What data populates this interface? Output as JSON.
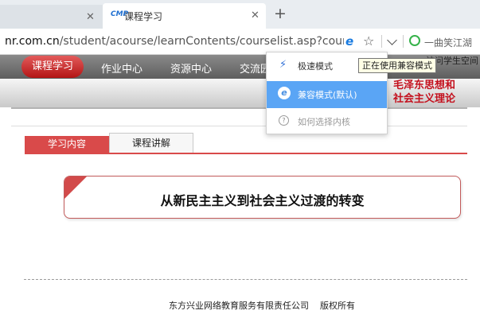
{
  "tabs": [
    {
      "title": "",
      "close": "✕"
    },
    {
      "favicon": "CMP",
      "title": "课程学习",
      "close": "✕"
    }
  ],
  "new_tab": "+",
  "address_bar": {
    "url_host": "nr.com.cn",
    "url_path": "/student/acourse/learnContents/courselist.asp?coursei",
    "ie_icon": "e",
    "star_icon": "☆",
    "search_text": "一曲笑江湖"
  },
  "site": {
    "nav": [
      "课程学习",
      "作业中心",
      "资源中心",
      "交流园"
    ],
    "nav_active_index": 0,
    "zone_text": "访问学生空间",
    "course_title_line1": "毛泽东思想和",
    "course_title_line2": "社会主义理论",
    "content_tabs": [
      "学习内容",
      "课程讲解"
    ],
    "lesson_title": "从新民主主义到社会主义过渡的转变",
    "footer_company": "东方兴业网络教育服务有限责任公司",
    "footer_rights": "版权所有"
  },
  "mode_menu": {
    "items": [
      {
        "label": "极速模式",
        "icon": "⚡"
      },
      {
        "label": "兼容模式(默认)",
        "icon": "e"
      },
      {
        "label": "如何选择内核",
        "icon": "?"
      }
    ],
    "selected_index": 1,
    "tooltip": "正在使用兼容模式"
  },
  "colors": {
    "accent": "#d94a4a",
    "menu_selected": "#5aa5f5",
    "course_title": "#c4101d"
  }
}
